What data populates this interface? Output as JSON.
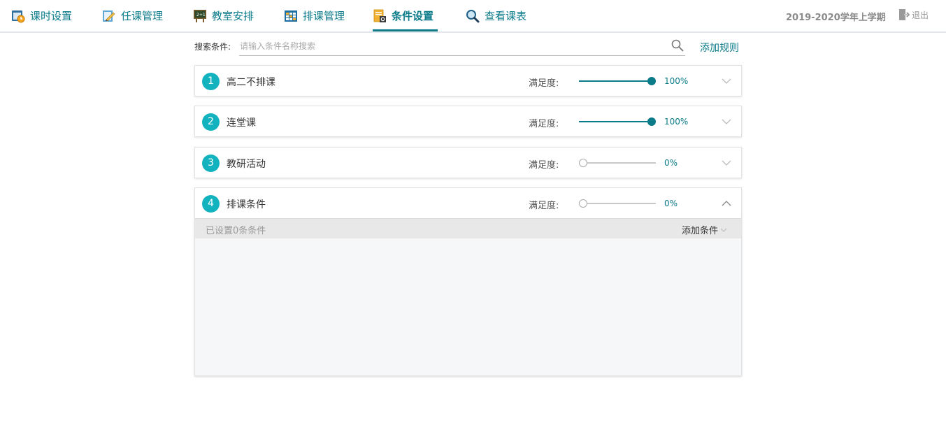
{
  "nav": {
    "items": [
      {
        "label": "课时设置",
        "icon": "clock-settings-icon"
      },
      {
        "label": "任课管理",
        "icon": "teacher-assign-icon"
      },
      {
        "label": "教室安排",
        "icon": "blackboard-icon"
      },
      {
        "label": "排课管理",
        "icon": "schedule-grid-icon"
      },
      {
        "label": "条件设置",
        "icon": "conditions-doc-icon"
      },
      {
        "label": "查看课表",
        "icon": "magnifier-icon"
      }
    ],
    "active_index": 4,
    "accent_color": "#0b7b89",
    "semester": "2019-2020学年上学期",
    "logout_label": "退出"
  },
  "search": {
    "label": "搜索条件:",
    "placeholder": "请输入条件名称搜索",
    "value": "",
    "add_rule_label": "添加规则"
  },
  "satisfaction_label": "满足度:",
  "rules": [
    {
      "number": "1",
      "name": "高二不排课",
      "satisfaction": 100,
      "percent_text": "100%",
      "expanded": false
    },
    {
      "number": "2",
      "name": "连堂课",
      "satisfaction": 100,
      "percent_text": "100%",
      "expanded": false
    },
    {
      "number": "3",
      "name": "教研活动",
      "satisfaction": 0,
      "percent_text": "0%",
      "expanded": false
    },
    {
      "number": "4",
      "name": "排课条件",
      "satisfaction": 0,
      "percent_text": "0%",
      "expanded": true
    }
  ],
  "expanded_panel": {
    "count_text": "已设置0条条件",
    "add_condition_label": "添加条件"
  }
}
